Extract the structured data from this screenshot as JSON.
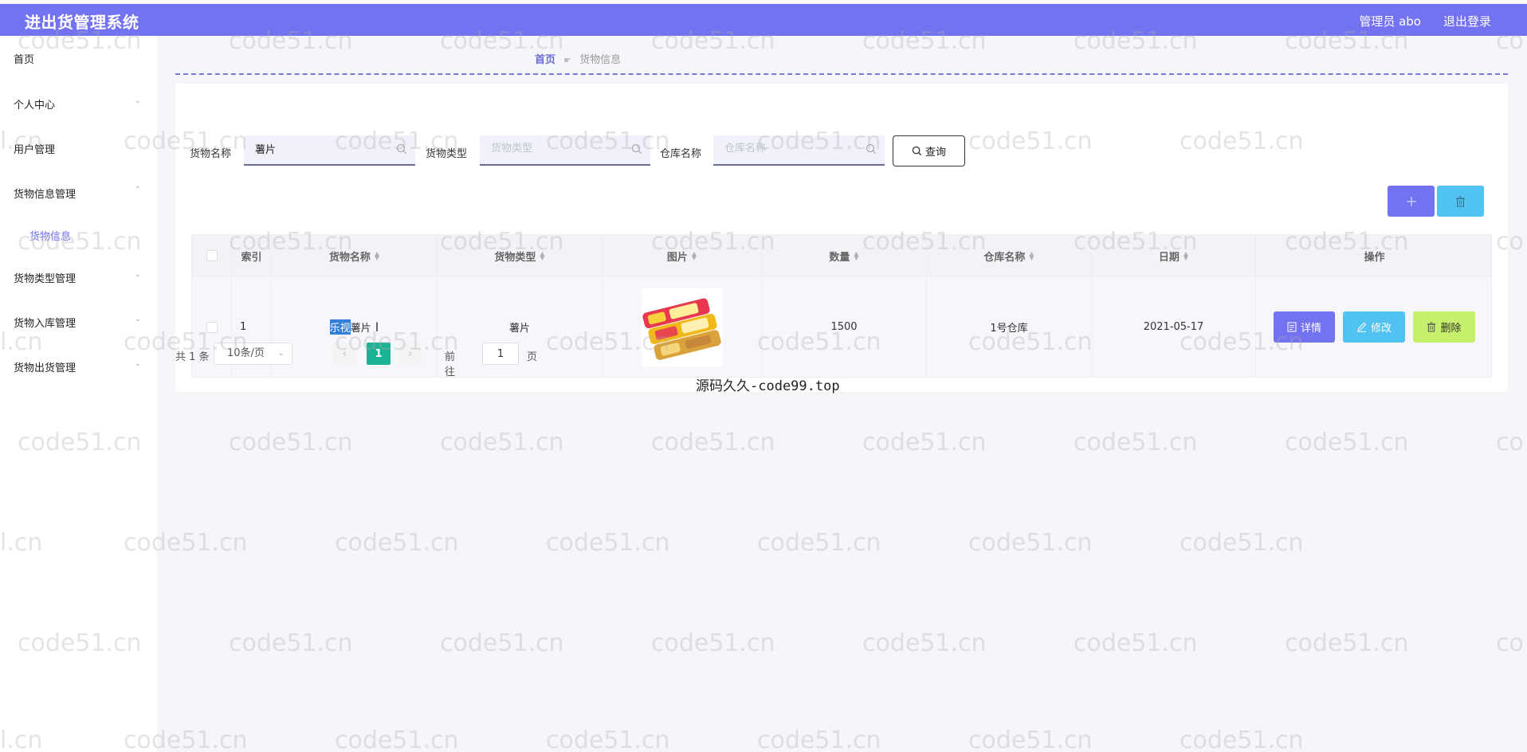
{
  "header": {
    "title": "进出货管理系统",
    "user": "管理员 abo",
    "logout": "退出登录",
    "bg_color": "#7373f2"
  },
  "sidebar": {
    "items": [
      {
        "label": "首页",
        "arrow": ""
      },
      {
        "label": "个人中心",
        "arrow": "⌄"
      },
      {
        "label": "用户管理",
        "arrow": ""
      },
      {
        "label": "货物信息管理",
        "arrow": "⌃"
      },
      {
        "label": "货物信息",
        "sub": true
      },
      {
        "label": "货物类型管理",
        "arrow": "⌄"
      },
      {
        "label": "货物入库管理",
        "arrow": "⌄"
      },
      {
        "label": "货物出货管理",
        "arrow": "⌄"
      }
    ]
  },
  "breadcrumb": {
    "home": "首页",
    "current": "货物信息"
  },
  "search": {
    "name_label": "货物名称",
    "name_value": "薯片",
    "type_label": "货物类型",
    "type_placeholder": "货物类型",
    "warehouse_label": "仓库名称",
    "warehouse_placeholder": "仓库名称",
    "query_label": "查询"
  },
  "table": {
    "headers": {
      "index": "索引",
      "name": "货物名称",
      "type": "货物类型",
      "image": "图片",
      "quantity": "数量",
      "warehouse": "仓库名称",
      "date": "日期",
      "ops": "操作"
    },
    "rows": [
      {
        "index": "1",
        "name_highlight": "乐视",
        "name_rest": "薯片",
        "type": "薯片",
        "quantity": "1500",
        "warehouse": "1号仓库",
        "date": "2021-05-17"
      }
    ],
    "ops": {
      "detail": "详情",
      "edit": "修改",
      "delete": "删除"
    }
  },
  "pagination": {
    "total": "共 1 条",
    "page_size": "10条/页",
    "prev": "‹",
    "current": "1",
    "next": "›",
    "goto_label": "前往",
    "goto_value": "1",
    "page_label": "页"
  },
  "overlay_text": "源码久久-code99.top",
  "watermark": "code51.cn",
  "watermark_partial": "l.cn",
  "watermark_edge": "co"
}
